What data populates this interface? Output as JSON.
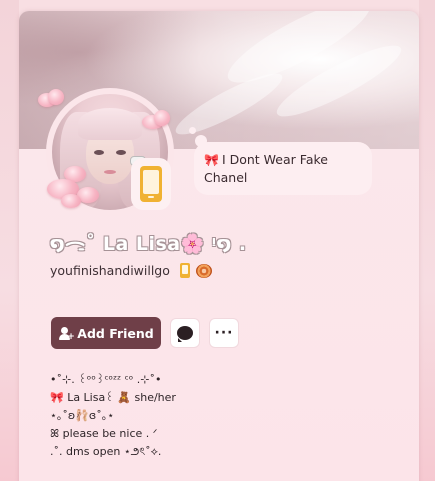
{
  "profile": {
    "display_name": "໑ᯏ˚ 𝗟𝗮 𝗟𝗶𝘀𝗮🌸 ᵎ໑ .",
    "username": "youfinishandiwillgo",
    "custom_status": {
      "emoji": "🎀",
      "text": "I Dont Wear Fake Chanel"
    },
    "status": "mobile-online",
    "badges": [
      "phone-icon",
      "snail-icon"
    ]
  },
  "actions": {
    "add_friend_label": "Add Friend",
    "message_icon": "chat-bubble-icon",
    "more_icon": "more-dots-icon",
    "more_label": "···"
  },
  "bio": {
    "lines": [
      "•˚⊹. ꒰ᵒᵒ꒱ᶜᵒᶻᶻ ᶜᵒ .⊹˚•",
      "🎀 La Lisa꒰ 🧸 she/her",
      "⋆｡˚ʚ🩰ɞ˚｡⋆",
      "ꕤ  please be nice .       ᐟ",
      ".˚. dms open ⋆౨ৎ˚⟡."
    ]
  },
  "colors": {
    "accent_button": "#6f3f48",
    "status_mobile": "#f0b232",
    "card_bg": "#fbe6ea"
  }
}
